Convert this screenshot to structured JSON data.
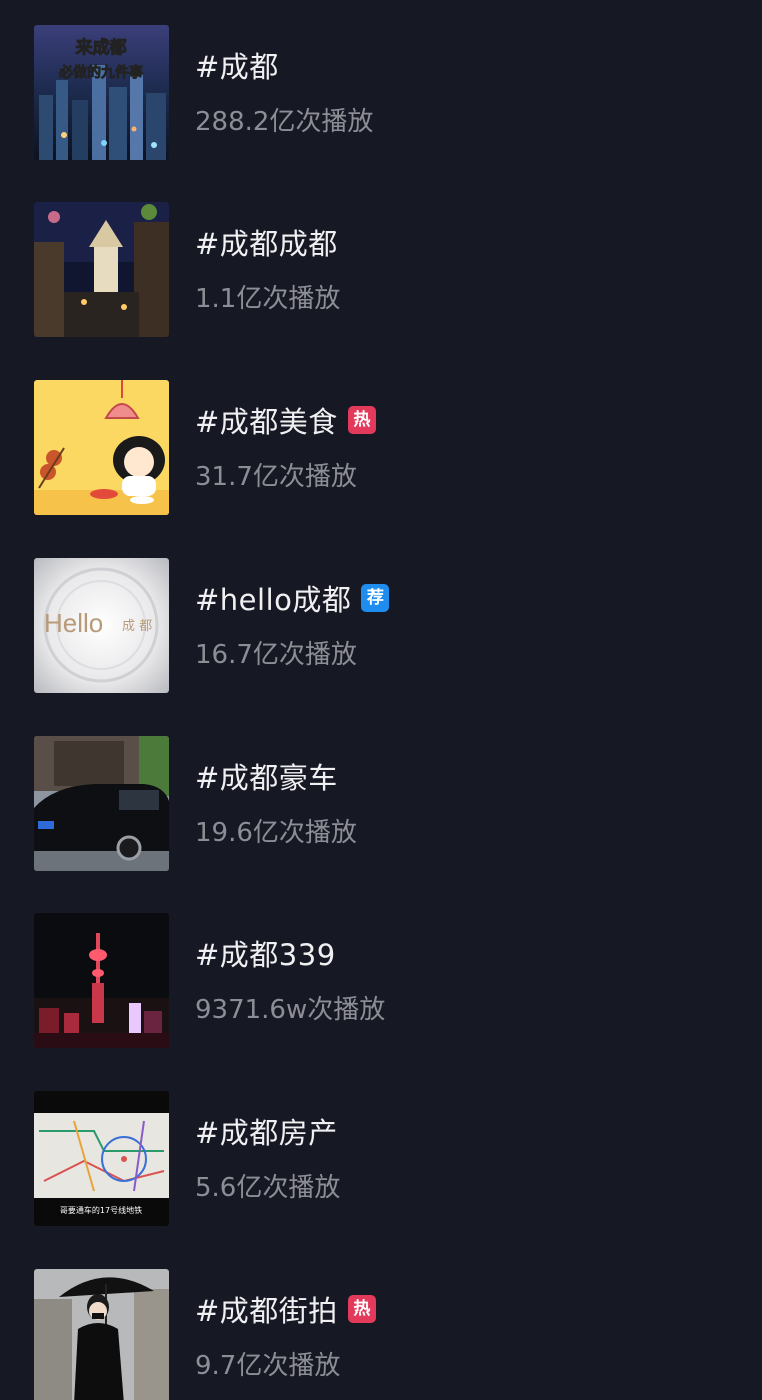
{
  "topics": [
    {
      "title": "#成都",
      "views": "288.2亿次播放",
      "thumb_text": [
        "来成都",
        "必做的九件事"
      ]
    },
    {
      "title": "#成都成都",
      "views": "1.1亿次播放"
    },
    {
      "title": "#成都美食",
      "views": "31.7亿次播放",
      "badge": "热"
    },
    {
      "title": "#hello成都",
      "views": "16.7亿次播放",
      "badge": "荐",
      "thumb_text": [
        "Hello",
        "成 都"
      ]
    },
    {
      "title": "#成都豪车",
      "views": "19.6亿次播放"
    },
    {
      "title": "#成都339",
      "views": "9371.6w次播放"
    },
    {
      "title": "#成都房产",
      "views": "5.6亿次播放",
      "thumb_text": [
        "哥要通车的17号线地铁"
      ]
    },
    {
      "title": "#成都街拍",
      "views": "9.7亿次播放",
      "badge": "热"
    }
  ],
  "colors": {
    "background": "#161823",
    "title": "#f0f0f2",
    "views": "#8d8e95",
    "badge_hot": "#e3395a",
    "badge_recommend": "#1f8cf0"
  }
}
